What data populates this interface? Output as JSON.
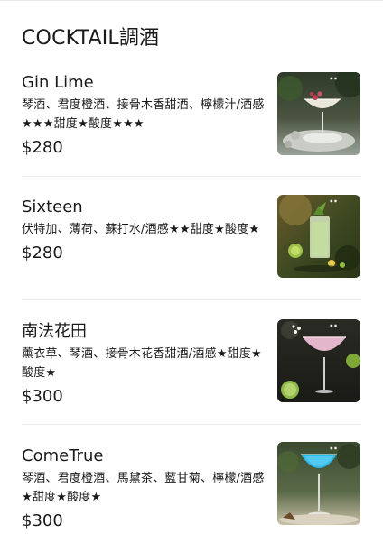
{
  "menu": {
    "section_title": "COCKTAIL調酒",
    "items": [
      {
        "name": "Gin Lime",
        "description": "琴酒、君度橙酒、接骨木香甜酒、檸檬汁/酒感★★★甜度★酸度★★★",
        "price": "$280",
        "photo": "cocktail-photo-gin-lime"
      },
      {
        "name": "Sixteen",
        "description": "伏特加、薄荷、蘇打水/酒感★★甜度★酸度★",
        "price": "$280",
        "photo": "cocktail-photo-sixteen"
      },
      {
        "name": "南法花田",
        "description": "薰衣草、琴酒、接骨木花香甜酒/酒感★甜度★酸度★",
        "price": "$300",
        "photo": "cocktail-photo-lavender"
      },
      {
        "name": "ComeTrue",
        "description": "琴酒、君度橙酒、馬黛茶、藍甘菊、檸檬/酒感★甜度★酸度★",
        "price": "$300",
        "photo": "cocktail-photo-blue"
      }
    ]
  },
  "colors": {
    "text": "#1a1a1a",
    "divider": "#ececec",
    "background": "#ffffff"
  }
}
